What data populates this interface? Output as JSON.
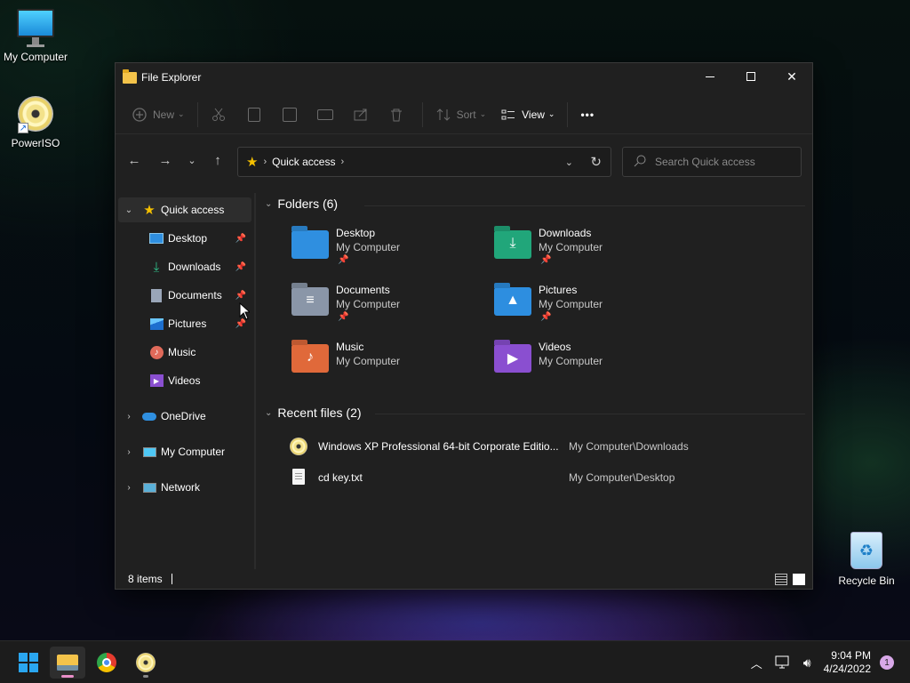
{
  "desktop": {
    "icons": [
      {
        "label": "My Computer"
      },
      {
        "label": "PowerISO"
      },
      {
        "label": "Recycle Bin"
      }
    ]
  },
  "window": {
    "title": "File Explorer",
    "controls": {
      "minimize": "—",
      "maximize": "☐",
      "close": "✕"
    }
  },
  "toolbar": {
    "new_label": "New",
    "sort_label": "Sort",
    "view_label": "View",
    "more_label": "•••"
  },
  "navigation": {
    "address": "Quick access",
    "search_placeholder": "Search Quick access"
  },
  "sidebar": {
    "quick_access": "Quick access",
    "pinned": [
      {
        "label": "Desktop",
        "icon": "desktop-icon",
        "pinned": true
      },
      {
        "label": "Downloads",
        "icon": "download-icon",
        "pinned": true
      },
      {
        "label": "Documents",
        "icon": "document-icon",
        "pinned": true
      },
      {
        "label": "Pictures",
        "icon": "picture-icon",
        "pinned": true
      },
      {
        "label": "Music",
        "icon": "music-icon",
        "pinned": false
      },
      {
        "label": "Videos",
        "icon": "video-icon",
        "pinned": false
      }
    ],
    "roots": [
      {
        "label": "OneDrive",
        "icon": "cloud-icon"
      },
      {
        "label": "My Computer",
        "icon": "computer-icon"
      },
      {
        "label": "Network",
        "icon": "network-icon"
      }
    ]
  },
  "content": {
    "folders_header": "Folders (6)",
    "folders": [
      {
        "name": "Desktop",
        "location": "My Computer",
        "pinned": true,
        "color": "#2f8fe0"
      },
      {
        "name": "Downloads",
        "location": "My Computer",
        "pinned": true,
        "color": "#21a67a"
      },
      {
        "name": "Documents",
        "location": "My Computer",
        "pinned": true,
        "color": "#8a96a8"
      },
      {
        "name": "Pictures",
        "location": "My Computer",
        "pinned": true,
        "color": "#2d8ee0"
      },
      {
        "name": "Music",
        "location": "My Computer",
        "pinned": false,
        "color": "#e0693a"
      },
      {
        "name": "Videos",
        "location": "My Computer",
        "pinned": false,
        "color": "#8a4fd0"
      }
    ],
    "recent_header": "Recent files (2)",
    "recent": [
      {
        "name": "Windows XP Professional 64-bit Corporate Editio...",
        "location": "My Computer\\Downloads",
        "icon": "disc-image-icon"
      },
      {
        "name": "cd key.txt",
        "location": "My Computer\\Desktop",
        "icon": "text-file-icon"
      }
    ]
  },
  "status": {
    "items": "8 items"
  },
  "taskbar": {
    "time": "9:04 PM",
    "date": "4/24/2022",
    "notifications": "1"
  }
}
